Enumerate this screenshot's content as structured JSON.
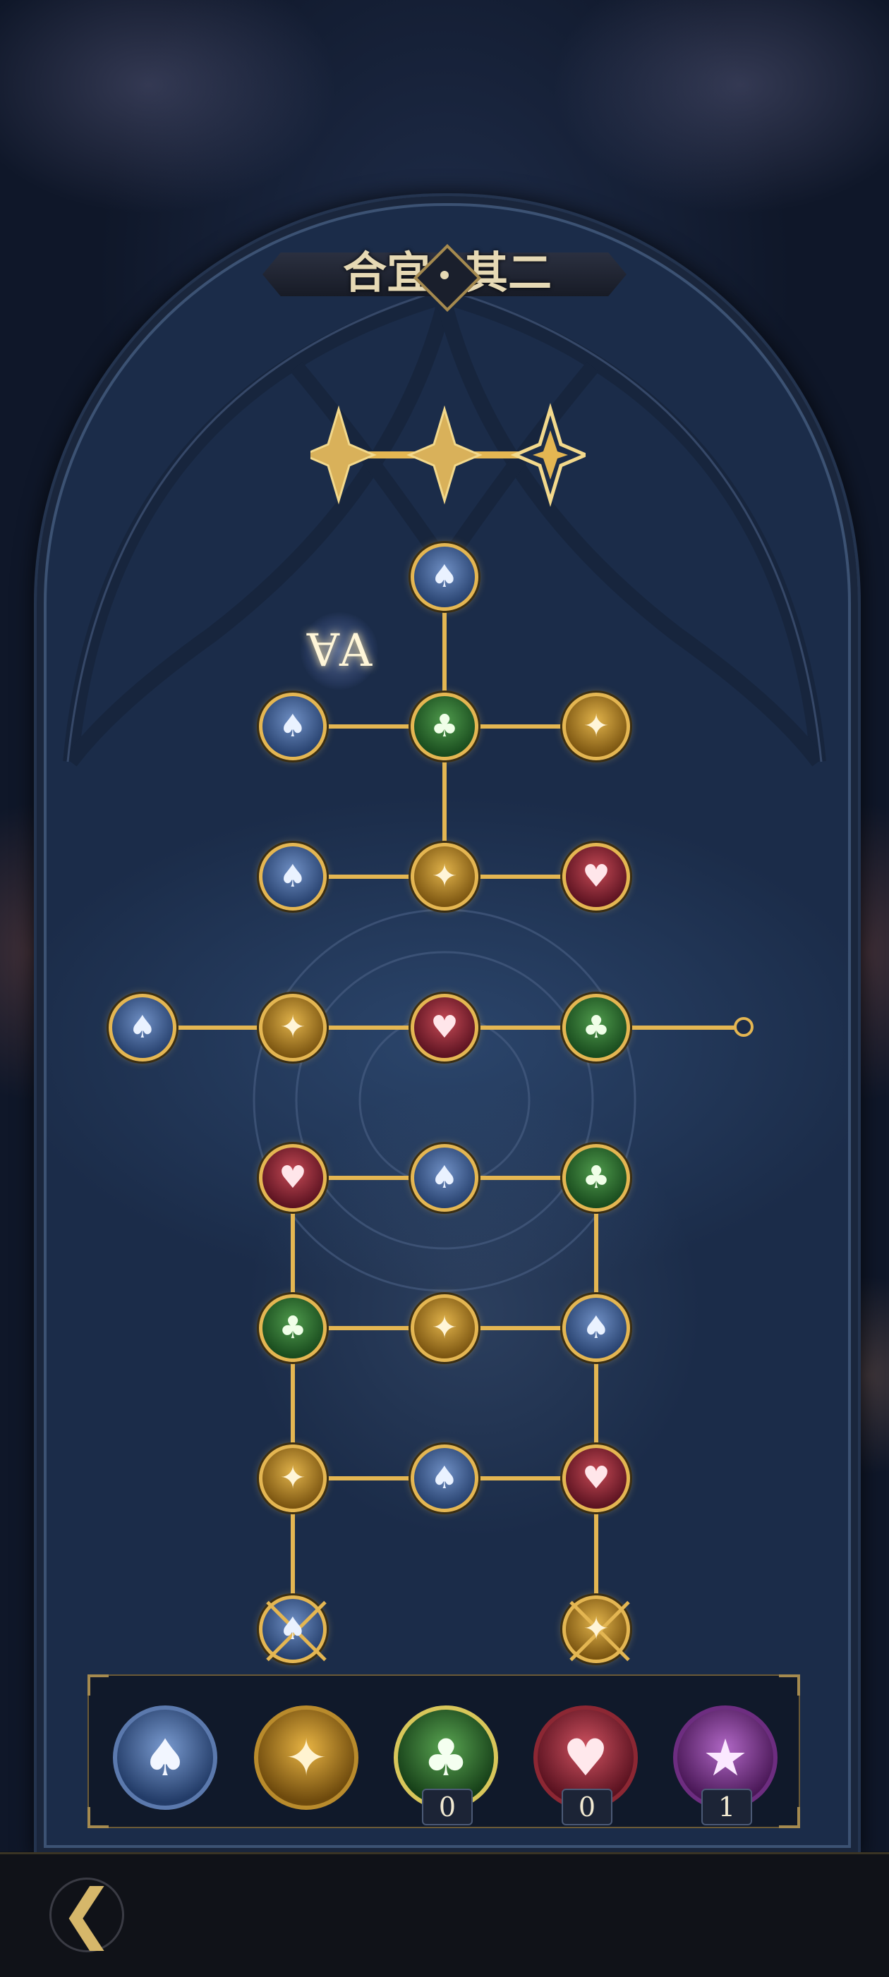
{
  "title": {
    "left": "合宜",
    "right": "其二"
  },
  "colors": {
    "gold": "#e4b652",
    "spade": "#26406d",
    "club": "#184a1d",
    "heart": "#5a1220",
    "diamond": "#7a5410",
    "star": "#4a1857"
  },
  "progress_stars": {
    "filled": 2,
    "total": 3
  },
  "tree": {
    "nodes": [
      {
        "id": "r1c2",
        "suit": "spade",
        "icon": "spade-icon",
        "glyph": "♠",
        "state": "open"
      },
      {
        "id": "r2c1",
        "suit": "spade",
        "icon": "spade-icon",
        "glyph": "♠",
        "state": "open"
      },
      {
        "id": "r2c2",
        "suit": "club",
        "icon": "club-icon",
        "glyph": "♣",
        "state": "open"
      },
      {
        "id": "r2c3",
        "suit": "diamond",
        "icon": "diamond-icon",
        "glyph": "✦",
        "state": "open"
      },
      {
        "id": "r3c1",
        "suit": "spade",
        "icon": "spade-icon",
        "glyph": "♠",
        "state": "open"
      },
      {
        "id": "r3c2",
        "suit": "diamond",
        "icon": "diamond-icon",
        "glyph": "✦",
        "state": "open"
      },
      {
        "id": "r3c3",
        "suit": "heart",
        "icon": "heart-icon",
        "glyph": "♥",
        "state": "open"
      },
      {
        "id": "r4c0",
        "suit": "spade",
        "icon": "spade-icon",
        "glyph": "♠",
        "state": "open"
      },
      {
        "id": "r4c1",
        "suit": "diamond",
        "icon": "diamond-icon",
        "glyph": "✦",
        "state": "open"
      },
      {
        "id": "r4c2",
        "suit": "heart",
        "icon": "heart-icon",
        "glyph": "♥",
        "state": "open"
      },
      {
        "id": "r4c3",
        "suit": "club",
        "icon": "club-icon",
        "glyph": "♣",
        "state": "open"
      },
      {
        "id": "r5c1",
        "suit": "heart",
        "icon": "heart-icon",
        "glyph": "♥",
        "state": "open"
      },
      {
        "id": "r5c2",
        "suit": "spade",
        "icon": "spade-icon",
        "glyph": "♠",
        "state": "open"
      },
      {
        "id": "r5c3",
        "suit": "club",
        "icon": "club-icon",
        "glyph": "♣",
        "state": "open"
      },
      {
        "id": "r6c1",
        "suit": "club",
        "icon": "club-icon",
        "glyph": "♣",
        "state": "open"
      },
      {
        "id": "r6c2",
        "suit": "diamond",
        "icon": "diamond-icon",
        "glyph": "✦",
        "state": "open"
      },
      {
        "id": "r6c3",
        "suit": "spade",
        "icon": "spade-icon",
        "glyph": "♠",
        "state": "open"
      },
      {
        "id": "r7c1",
        "suit": "diamond",
        "icon": "diamond-icon",
        "glyph": "✦",
        "state": "open"
      },
      {
        "id": "r7c2",
        "suit": "spade",
        "icon": "spade-icon",
        "glyph": "♠",
        "state": "open"
      },
      {
        "id": "r7c3",
        "suit": "heart",
        "icon": "heart-icon",
        "glyph": "♥",
        "state": "open"
      },
      {
        "id": "r8c1",
        "suit": "spade",
        "icon": "spade-icon",
        "glyph": "♠",
        "state": "locked"
      },
      {
        "id": "r8c3",
        "suit": "diamond",
        "icon": "diamond-icon",
        "glyph": "✦",
        "state": "locked"
      }
    ]
  },
  "legend": [
    {
      "suit": "spade",
      "icon": "spade-icon",
      "glyph": "♠",
      "count": null
    },
    {
      "suit": "diamond",
      "icon": "diamond-icon",
      "glyph": "✦",
      "count": null
    },
    {
      "suit": "club",
      "icon": "club-icon",
      "glyph": "♣",
      "count": "0"
    },
    {
      "suit": "heart",
      "icon": "heart-icon",
      "glyph": "♥",
      "count": "0"
    },
    {
      "suit": "star",
      "icon": "star-icon",
      "glyph": "★",
      "count": "1"
    }
  ],
  "rune_glyph": "ⱯA",
  "back_glyph": "❮"
}
